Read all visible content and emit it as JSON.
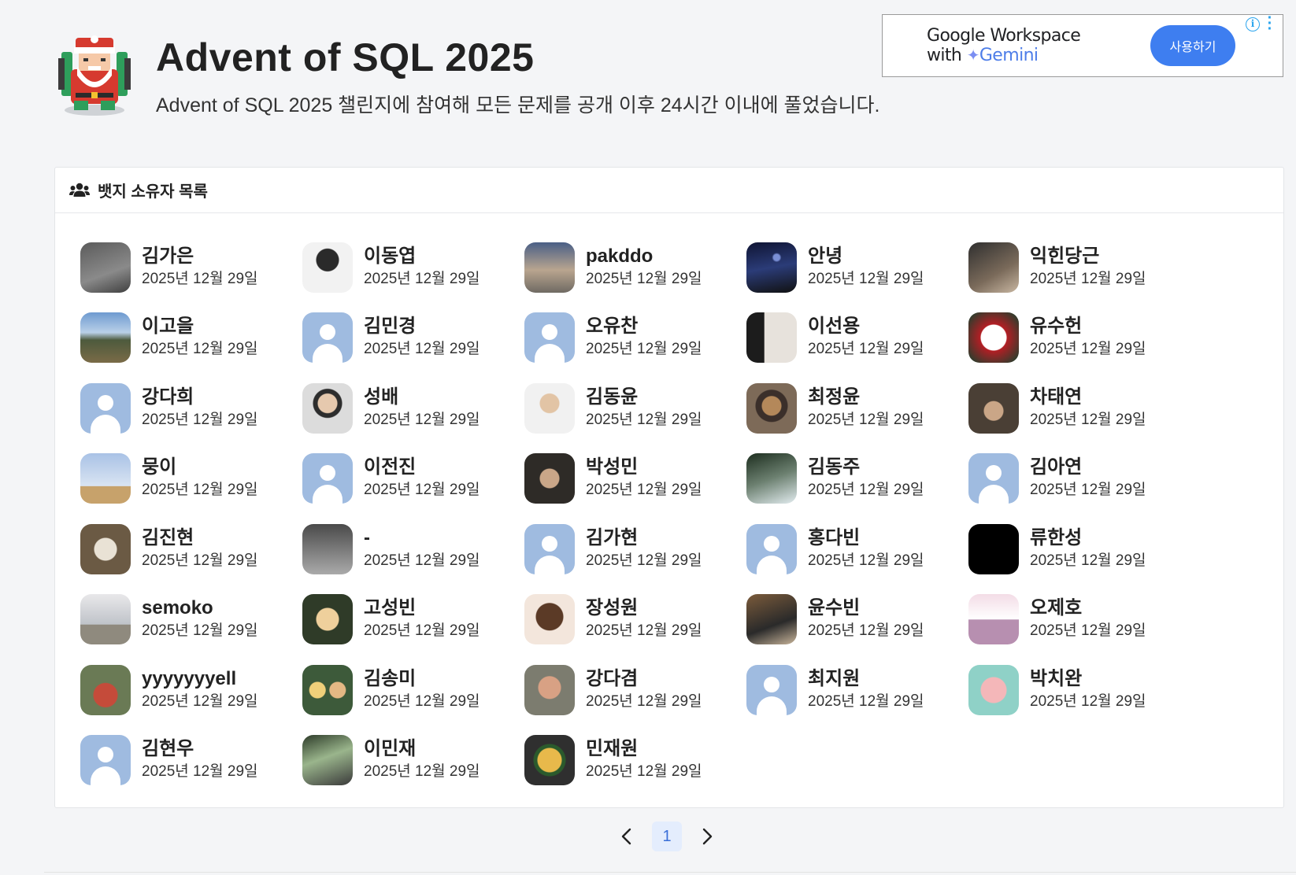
{
  "header": {
    "title": "Advent of SQL 2025",
    "description": "Advent of SQL 2025 챌린지에 참여해 모든 문제를 공개 이후 24시간 이내에 풀었습니다."
  },
  "ad": {
    "line1": "Google Workspace",
    "line2_prefix": "with",
    "line2_brand": "Gemini",
    "cta": "사용하기",
    "info_icon": "info-icon",
    "menu_icon": "kebab-menu-icon"
  },
  "card": {
    "title": "뱃지 소유자 목록",
    "icon": "users-icon"
  },
  "holders": [
    {
      "name": "김가은",
      "date": "2025년 12월 29일",
      "avatar": "photo"
    },
    {
      "name": "이동엽",
      "date": "2025년 12월 29일",
      "avatar": "photo"
    },
    {
      "name": "pakddo",
      "date": "2025년 12월 29일",
      "avatar": "photo"
    },
    {
      "name": "안녕",
      "date": "2025년 12월 29일",
      "avatar": "photo"
    },
    {
      "name": "익힌당근",
      "date": "2025년 12월 29일",
      "avatar": "photo"
    },
    {
      "name": "이고을",
      "date": "2025년 12월 29일",
      "avatar": "photo"
    },
    {
      "name": "김민경",
      "date": "2025년 12월 29일",
      "avatar": "placeholder"
    },
    {
      "name": "오유찬",
      "date": "2025년 12월 29일",
      "avatar": "placeholder"
    },
    {
      "name": "이선용",
      "date": "2025년 12월 29일",
      "avatar": "photo"
    },
    {
      "name": "유수헌",
      "date": "2025년 12월 29일",
      "avatar": "photo"
    },
    {
      "name": "강다희",
      "date": "2025년 12월 29일",
      "avatar": "placeholder"
    },
    {
      "name": "성배",
      "date": "2025년 12월 29일",
      "avatar": "photo"
    },
    {
      "name": "김동윤",
      "date": "2025년 12월 29일",
      "avatar": "photo"
    },
    {
      "name": "최정윤",
      "date": "2025년 12월 29일",
      "avatar": "photo",
      "highlighted": true
    },
    {
      "name": "차태연",
      "date": "2025년 12월 29일",
      "avatar": "photo"
    },
    {
      "name": "뭉이",
      "date": "2025년 12월 29일",
      "avatar": "photo"
    },
    {
      "name": "이전진",
      "date": "2025년 12월 29일",
      "avatar": "placeholder"
    },
    {
      "name": "박성민",
      "date": "2025년 12월 29일",
      "avatar": "photo"
    },
    {
      "name": "김동주",
      "date": "2025년 12월 29일",
      "avatar": "photo"
    },
    {
      "name": "김아연",
      "date": "2025년 12월 29일",
      "avatar": "placeholder"
    },
    {
      "name": "김진현",
      "date": "2025년 12월 29일",
      "avatar": "photo"
    },
    {
      "name": "-",
      "date": "2025년 12월 29일",
      "avatar": "photo"
    },
    {
      "name": "김가현",
      "date": "2025년 12월 29일",
      "avatar": "placeholder"
    },
    {
      "name": "홍다빈",
      "date": "2025년 12월 29일",
      "avatar": "placeholder"
    },
    {
      "name": "류한성",
      "date": "2025년 12월 29일",
      "avatar": "photo"
    },
    {
      "name": "semoko",
      "date": "2025년 12월 29일",
      "avatar": "photo"
    },
    {
      "name": "고성빈",
      "date": "2025년 12월 29일",
      "avatar": "photo"
    },
    {
      "name": "장성원",
      "date": "2025년 12월 29일",
      "avatar": "photo"
    },
    {
      "name": "윤수빈",
      "date": "2025년 12월 29일",
      "avatar": "photo"
    },
    {
      "name": "오제호",
      "date": "2025년 12월 29일",
      "avatar": "photo"
    },
    {
      "name": "yyyyyyyell",
      "date": "2025년 12월 29일",
      "avatar": "photo"
    },
    {
      "name": "김송미",
      "date": "2025년 12월 29일",
      "avatar": "photo"
    },
    {
      "name": "강다겸",
      "date": "2025년 12월 29일",
      "avatar": "photo"
    },
    {
      "name": "최지원",
      "date": "2025년 12월 29일",
      "avatar": "placeholder"
    },
    {
      "name": "박치완",
      "date": "2025년 12월 29일",
      "avatar": "photo"
    },
    {
      "name": "김현우",
      "date": "2025년 12월 29일",
      "avatar": "placeholder"
    },
    {
      "name": "이민재",
      "date": "2025년 12월 29일",
      "avatar": "photo"
    },
    {
      "name": "민재원",
      "date": "2025년 12월 29일",
      "avatar": "photo"
    }
  ],
  "pagination": {
    "current_page": "1",
    "prev_icon": "chevron-left-icon",
    "next_icon": "chevron-right-icon"
  },
  "colors": {
    "accent": "#3e7ef0",
    "highlight": "#e8462b",
    "placeholder_avatar": "#9fbbe0",
    "page_active_bg": "#e4edfd"
  }
}
